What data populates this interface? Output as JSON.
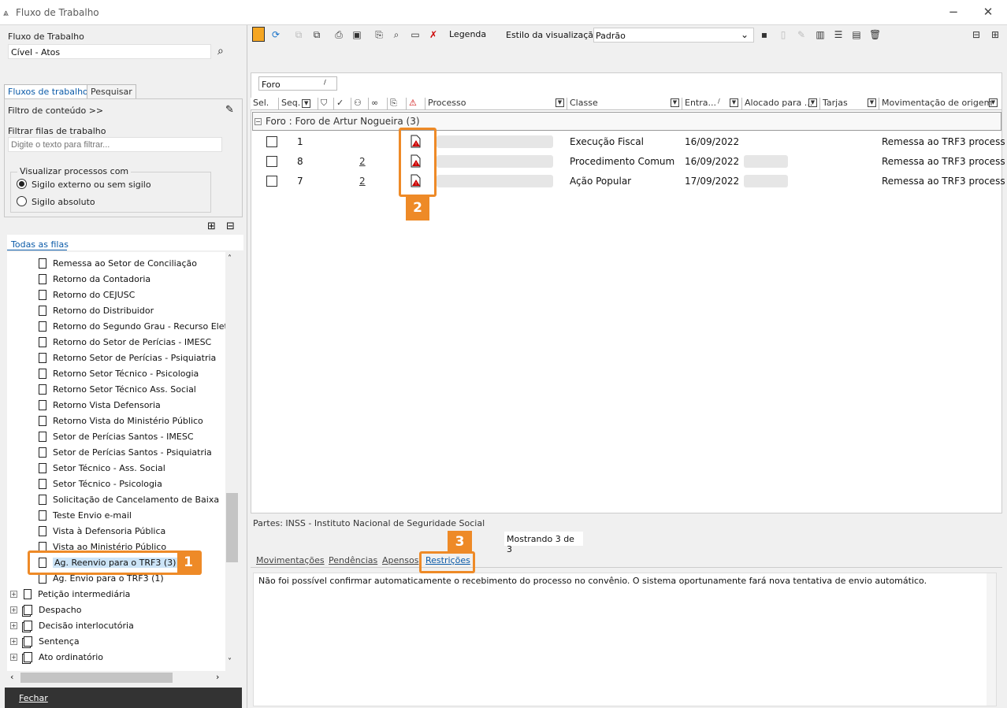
{
  "window": {
    "title": "Fluxo de Trabalho",
    "minimize_icon": "−",
    "close_icon": "✕"
  },
  "left": {
    "workflow_label": "Fluxo de Trabalho",
    "workflow_value": "Cível - Atos",
    "tabs": [
      "Fluxos de trabalho",
      "Pesquisar"
    ],
    "content_filter": "Filtro de conteúdo >>",
    "filter_queues_label": "Filtrar filas de trabalho",
    "filter_placeholder": "Digite o texto para filtrar...",
    "view_group_label": "Visualizar processos com",
    "radio_options": [
      {
        "label": "Sigilo externo ou sem sigilo",
        "checked": true
      },
      {
        "label": "Sigilo absoluto",
        "checked": false
      }
    ],
    "all_queues_label": "Todas as filas",
    "tree_items": [
      "Remessa ao Setor de Conciliação",
      "Retorno da Contadoria",
      "Retorno do CEJUSC",
      "Retorno do Distribuidor",
      "Retorno do Segundo Grau - Recurso  Eletr",
      "Retorno do Setor de Perícias - IMESC",
      "Retorno Setor de Perícias - Psiquiatria",
      "Retorno Setor Técnico - Psicologia",
      "Retorno Setor Técnico Ass. Social",
      "Retorno Vista Defensoria",
      "Retorno Vista do Ministério Público",
      "Setor de Perícias  Santos - IMESC",
      "Setor de Perícias Santos - Psiquiatria",
      "Setor Técnico - Ass. Social",
      "Setor Técnico - Psicologia",
      "Solicitação de Cancelamento de Baixa",
      "Teste Envio e-mail",
      "Vista à Defensoria Pública",
      "Vista ao Ministério Público",
      "Ag. Reenvio  para o TRF3 (3)",
      "Ag. Envio  para o TRF3 (1)"
    ],
    "tree_groups": [
      "Petição intermediária",
      "Despacho",
      "Decisão interlocutória",
      "Sentença",
      "Ato ordinatório"
    ],
    "close_button": "Fechar"
  },
  "toolbar": {
    "legend": "Legenda",
    "view_style_label": "Estilo da visualização",
    "view_style_value": "Padrão"
  },
  "grid": {
    "group_by_chip": "Foro",
    "columns": [
      "Sel.",
      "Seq.",
      "Processo",
      "Classe",
      "Entra...",
      "Alocado para ...",
      "Tarjas",
      "Movimentação de origem"
    ],
    "group_row": "Foro : Foro de Artur Nogueira  (3)",
    "rows": [
      {
        "seq": "1",
        "link": "",
        "classe": "Execução Fiscal",
        "entrada": "16/09/2022",
        "mov": "Remessa ao TRF3 process"
      },
      {
        "seq": "8",
        "link": "2",
        "classe": "Procedimento Comum",
        "entrada": "16/09/2022",
        "mov": "Remessa ao TRF3 process"
      },
      {
        "seq": "7",
        "link": "2",
        "classe": "Ação Popular",
        "entrada": "17/09/2022",
        "mov": "Remessa ao TRF3 process"
      }
    ]
  },
  "status": {
    "partes": "Partes: INSS - Instituto Nacional de Seguridade Social",
    "showing": "Mostrando 3 de 3"
  },
  "bottom_tabs": [
    "Movimentações",
    "Pendências",
    "Apensos",
    "Restrições"
  ],
  "message": "Não foi possível confirmar automaticamente o recebimento do processo no convênio. O sistema oportunamente fará nova tentativa de envio automático.",
  "callouts": [
    "1",
    "2",
    "3"
  ],
  "colors": {
    "accent": "#ee8a27",
    "selected": "#cce4f7",
    "link": "#0a5aa8"
  }
}
